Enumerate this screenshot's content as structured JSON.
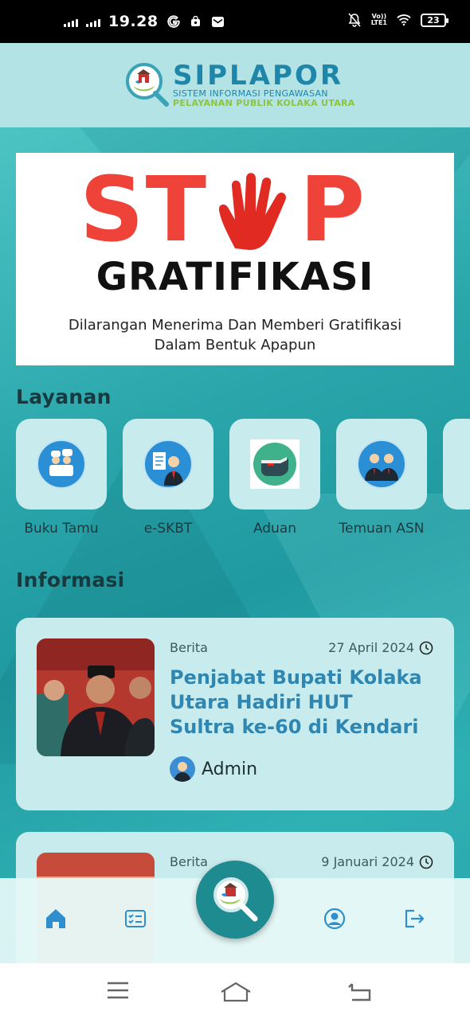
{
  "status_bar": {
    "time": "19.28",
    "battery": "23",
    "network": "LTE1"
  },
  "header": {
    "brand": "SIPLAPOR",
    "tagline1": "SISTEM INFORMASI PENGAWASAN",
    "tagline2": "PELAYANAN PUBLIK KOLAKA UTARA"
  },
  "banner": {
    "stop_left": "ST",
    "stop_right": "P",
    "headline": "GRATIFIKASI",
    "line1": "Dilarangan Menerima Dan Memberi Gratifikasi",
    "line2": "Dalam Bentuk Apapun"
  },
  "layanan": {
    "title": "Layanan",
    "items": [
      {
        "label": "Buku Tamu",
        "icon": "guest-book-icon"
      },
      {
        "label": "e-SKBT",
        "icon": "certificate-icon"
      },
      {
        "label": "Aduan",
        "icon": "whistle-icon"
      },
      {
        "label": "Temuan ASN",
        "icon": "officials-icon"
      }
    ]
  },
  "informasi": {
    "title": "Informasi",
    "items": [
      {
        "category": "Berita",
        "date": "27 April 2024",
        "title": "Penjabat Bupati Kolaka Utara Hadiri HUT Sultra ke-60 di Kendari",
        "author": "Admin"
      },
      {
        "category": "Berita",
        "date": "9 Januari 2024"
      }
    ]
  },
  "colors": {
    "primary": "#1d86a9",
    "accent": "#8bc43f",
    "stop_red": "#ef4239",
    "teal": "#2bb3b7",
    "card": "#c8ecee"
  }
}
